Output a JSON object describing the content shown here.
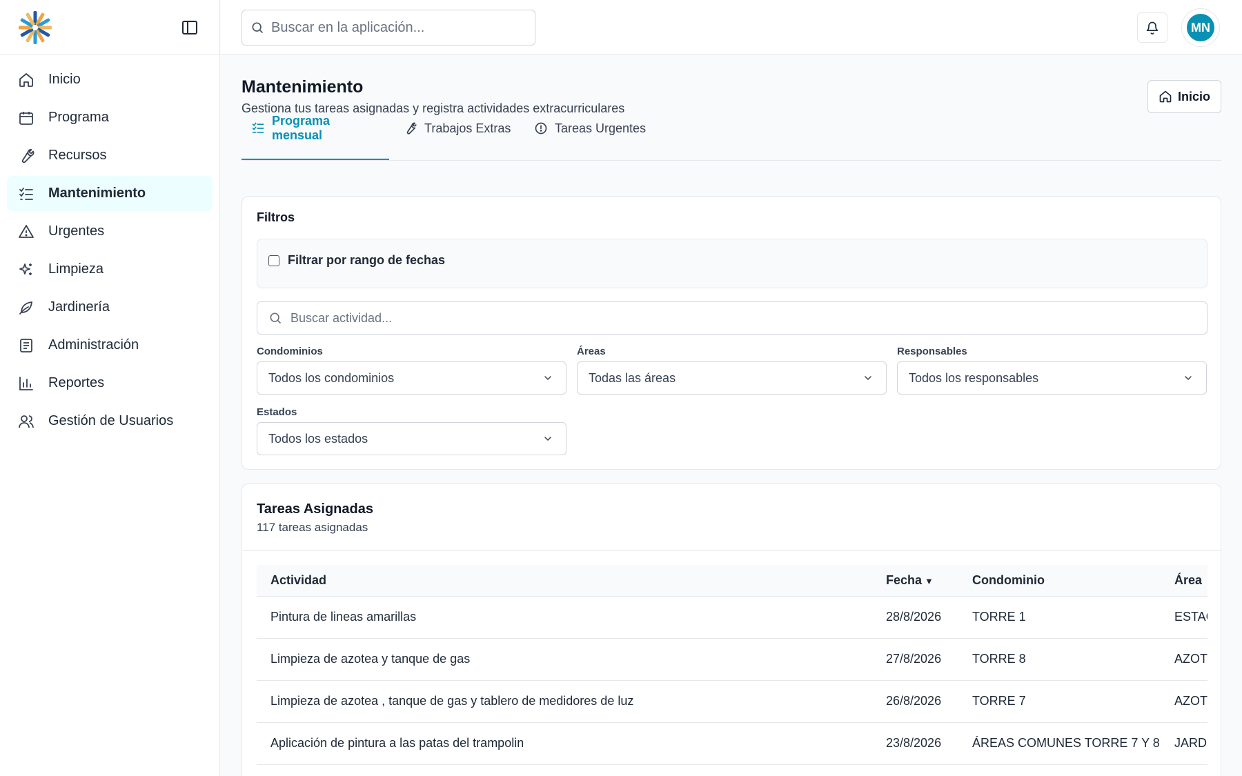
{
  "search": {
    "placeholder": "Buscar en la aplicación..."
  },
  "user": {
    "initials": "MN"
  },
  "sidebar": {
    "items": [
      {
        "label": "Inicio",
        "icon": "home-icon"
      },
      {
        "label": "Programa",
        "icon": "calendar-icon"
      },
      {
        "label": "Recursos",
        "icon": "wrench-icon"
      },
      {
        "label": "Mantenimiento",
        "icon": "checklist-icon",
        "active": true
      },
      {
        "label": "Urgentes",
        "icon": "alert-triangle-icon"
      },
      {
        "label": "Limpieza",
        "icon": "sparkles-icon"
      },
      {
        "label": "Jardinería",
        "icon": "leaf-icon"
      },
      {
        "label": "Administración",
        "icon": "document-icon"
      },
      {
        "label": "Reportes",
        "icon": "bar-chart-icon"
      },
      {
        "label": "Gestión de Usuarios",
        "icon": "users-icon"
      }
    ]
  },
  "page": {
    "title": "Mantenimiento",
    "subtitle": "Gestiona tus tareas asignadas y registra actividades extracurriculares",
    "home_button": "Inicio"
  },
  "tabs": [
    {
      "label": "Programa mensual",
      "icon": "list-check-icon",
      "active": true
    },
    {
      "label": "Trabajos Extras",
      "icon": "wrench-icon"
    },
    {
      "label": "Tareas Urgentes",
      "icon": "alert-circle-icon"
    }
  ],
  "filters": {
    "title": "Filtros",
    "date_range_label": "Filtrar por rango de fechas",
    "date_range_checked": false,
    "activity_search_placeholder": "Buscar actividad...",
    "condominios": {
      "label": "Condominios",
      "value": "Todos los condominios"
    },
    "areas": {
      "label": "Áreas",
      "value": "Todas las áreas"
    },
    "responsables": {
      "label": "Responsables",
      "value": "Todos los responsables"
    },
    "estados": {
      "label": "Estados",
      "value": "Todos los estados"
    }
  },
  "tasks": {
    "title": "Tareas Asignadas",
    "count_text": "117 tareas asignadas",
    "columns": {
      "actividad": "Actividad",
      "fecha": "Fecha",
      "condominio": "Condominio",
      "area": "Área"
    },
    "sort_indicator": "▼",
    "rows": [
      {
        "actividad": "Pintura de lineas amarillas",
        "fecha": "28/8/2026",
        "condominio": "TORRE 1",
        "area": "ESTAC"
      },
      {
        "actividad": "Limpieza de azotea y tanque de gas",
        "fecha": "27/8/2026",
        "condominio": "TORRE 8",
        "area": "AZOTI"
      },
      {
        "actividad": "Limpieza de azotea , tanque de gas y tablero de medidores de luz",
        "fecha": "26/8/2026",
        "condominio": "TORRE 7",
        "area": "AZOTI"
      },
      {
        "actividad": "Aplicación de pintura a las patas del trampolin",
        "fecha": "23/8/2026",
        "condominio": "ÁREAS COMUNES TORRE 7 Y 8",
        "area": "JARDI"
      }
    ]
  },
  "colors": {
    "accent": "#0891b2",
    "active_bg": "#ecfeff",
    "border": "#e5e7eb"
  }
}
